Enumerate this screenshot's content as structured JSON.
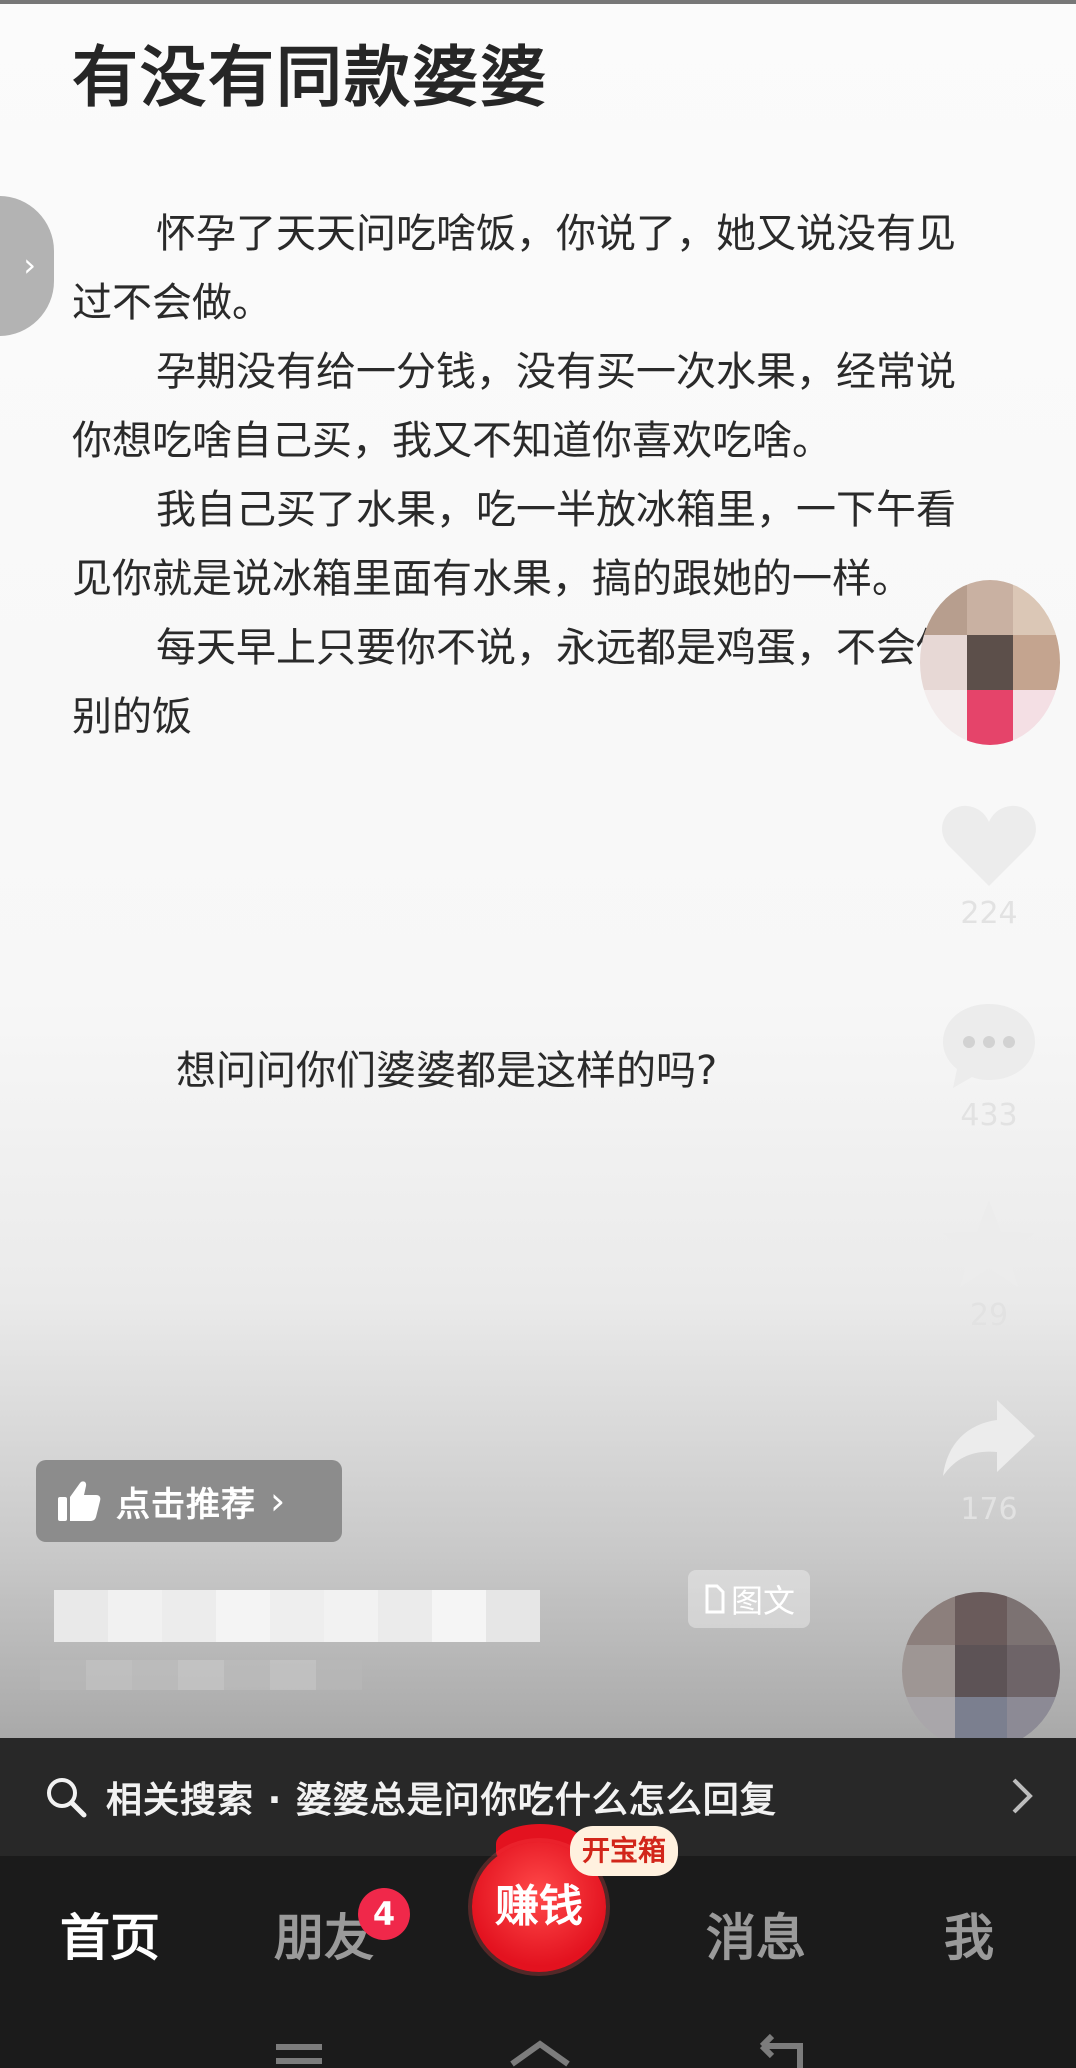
{
  "post": {
    "title": "有没有同款婆婆",
    "paragraphs": [
      "怀孕了天天问吃啥饭，你说了，她又说没有见过不会做。",
      "孕期没有给一分钱，没有买一次水果，经常说你想吃啥自己买，我又不知道你喜欢吃啥。",
      "我自己买了水果，吃一半放冰箱里，一下午看见你就是说冰箱里面有水果，搞的跟她的一样。",
      "每天早上只要你不说，永远都是鸡蛋，不会做别的饭"
    ],
    "question": "想问问你们婆婆都是这样的吗?"
  },
  "actions": {
    "likes": "224",
    "comments": "433",
    "favorites": "29",
    "shares": "176"
  },
  "recommend_label": "点击推荐",
  "content_tag": "图文",
  "related_search": {
    "prefix": "相关搜索",
    "separator": "·",
    "query": "婆婆总是问你吃什么怎么回复"
  },
  "tabbar": {
    "home": "首页",
    "friends": "朋友",
    "friends_badge": "4",
    "earn": "赚钱",
    "treasure": "开宝箱",
    "messages": "消息",
    "me": "我"
  }
}
